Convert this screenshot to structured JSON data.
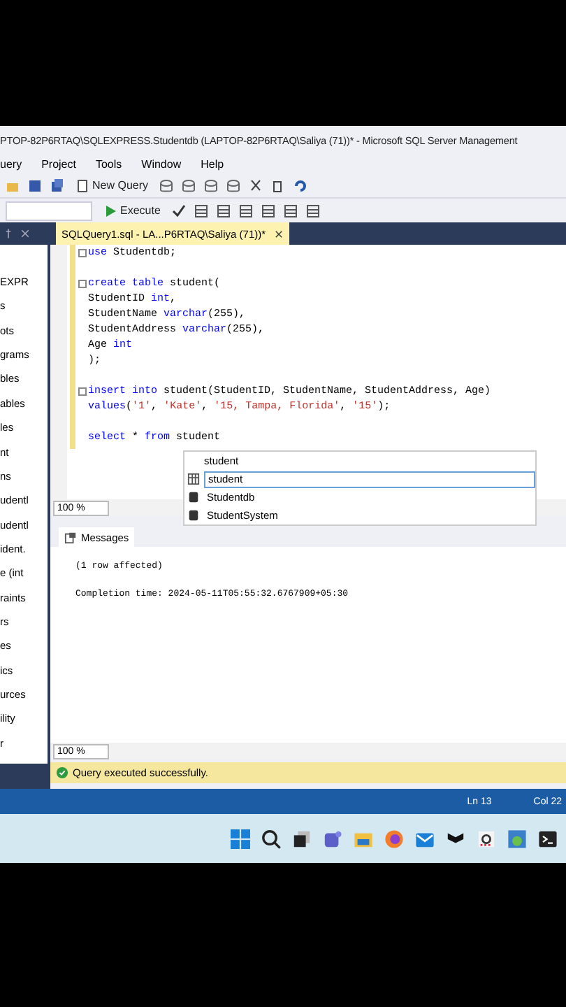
{
  "window": {
    "title": "PTOP-82P6RTAQ\\SQLEXPRESS.Studentdb (LAPTOP-82P6RTAQ\\Saliya (71))* - Microsoft SQL Server Management"
  },
  "menu": [
    "uery",
    "Project",
    "Tools",
    "Window",
    "Help"
  ],
  "toolbar": {
    "new_query": "New Query",
    "execute": "Execute"
  },
  "explorer": {
    "items": [
      "EXPR",
      "s",
      "ots",
      "grams",
      "bles",
      "ables",
      "les",
      "nt",
      "ns",
      "udentl",
      "udentl",
      "ident.",
      "e (int",
      "raints",
      "rs",
      "es",
      "ics",
      "urces",
      "ility",
      "r"
    ]
  },
  "editor_tab": {
    "title": "SQLQuery1.sql - LA...P6RTAQ\\Saliya (71))*"
  },
  "code": [
    {
      "fold": true,
      "tokens": [
        {
          "kind": "kw",
          "text": "use"
        },
        {
          "kind": "plain",
          "text": " Studentdb;"
        }
      ]
    },
    {
      "fold": false
    },
    {
      "fold": true,
      "tokens": [
        {
          "kind": "kw",
          "text": "create table"
        },
        {
          "kind": "plain",
          "text": " student("
        }
      ]
    },
    {
      "fold": false,
      "tokens": [
        {
          "kind": "plain",
          "text": "StudentID "
        },
        {
          "kind": "kw",
          "text": "int"
        },
        {
          "kind": "plain",
          "text": ","
        }
      ]
    },
    {
      "fold": false,
      "tokens": [
        {
          "kind": "plain",
          "text": "StudentName "
        },
        {
          "kind": "kw",
          "text": "varchar"
        },
        {
          "kind": "plain",
          "text": "(255),"
        }
      ]
    },
    {
      "fold": false,
      "tokens": [
        {
          "kind": "plain",
          "text": "StudentAddress "
        },
        {
          "kind": "kw",
          "text": "varchar"
        },
        {
          "kind": "plain",
          "text": "(255),"
        }
      ]
    },
    {
      "fold": false,
      "tokens": [
        {
          "kind": "plain",
          "text": "Age "
        },
        {
          "kind": "kw",
          "text": "int"
        }
      ]
    },
    {
      "fold": false,
      "tokens": [
        {
          "kind": "plain",
          "text": ");"
        }
      ]
    },
    {
      "fold": false
    },
    {
      "fold": true,
      "tokens": [
        {
          "kind": "kw",
          "text": "insert into"
        },
        {
          "kind": "plain",
          "text": " student(StudentID, StudentName, StudentAddress, Age)"
        }
      ]
    },
    {
      "fold": false,
      "tokens": [
        {
          "kind": "kw",
          "text": "values"
        },
        {
          "kind": "plain",
          "text": "("
        },
        {
          "kind": "str",
          "text": "'1'"
        },
        {
          "kind": "plain",
          "text": ", "
        },
        {
          "kind": "str",
          "text": "'Kate'"
        },
        {
          "kind": "plain",
          "text": ", "
        },
        {
          "kind": "str",
          "text": "'15, Tampa, Florida'"
        },
        {
          "kind": "plain",
          "text": ", "
        },
        {
          "kind": "str",
          "text": "'15'"
        },
        {
          "kind": "plain",
          "text": ");"
        }
      ]
    },
    {
      "fold": false
    },
    {
      "fold": false,
      "tokens": [
        {
          "kind": "kw",
          "text": "select"
        },
        {
          "kind": "plain",
          "text": " * "
        },
        {
          "kind": "kw",
          "text": "from"
        },
        {
          "kind": "plain",
          "text": " student"
        }
      ]
    }
  ],
  "autocomplete": {
    "header": "student",
    "items": [
      {
        "text": "student",
        "kind": "table",
        "selected": true
      },
      {
        "text": "Studentdb",
        "kind": "database",
        "selected": false
      },
      {
        "text": "StudentSystem",
        "kind": "database",
        "selected": false
      }
    ]
  },
  "editor_zoom": "100 %",
  "results_tab": "Messages",
  "messages": [
    "(1 row affected)",
    "Completion time: 2024-05-11T05:55:32.6767909+05:30"
  ],
  "results_zoom": "100 %",
  "status": "Query executed successfully.",
  "position": {
    "line": "Ln 13",
    "column": "Col 22"
  }
}
